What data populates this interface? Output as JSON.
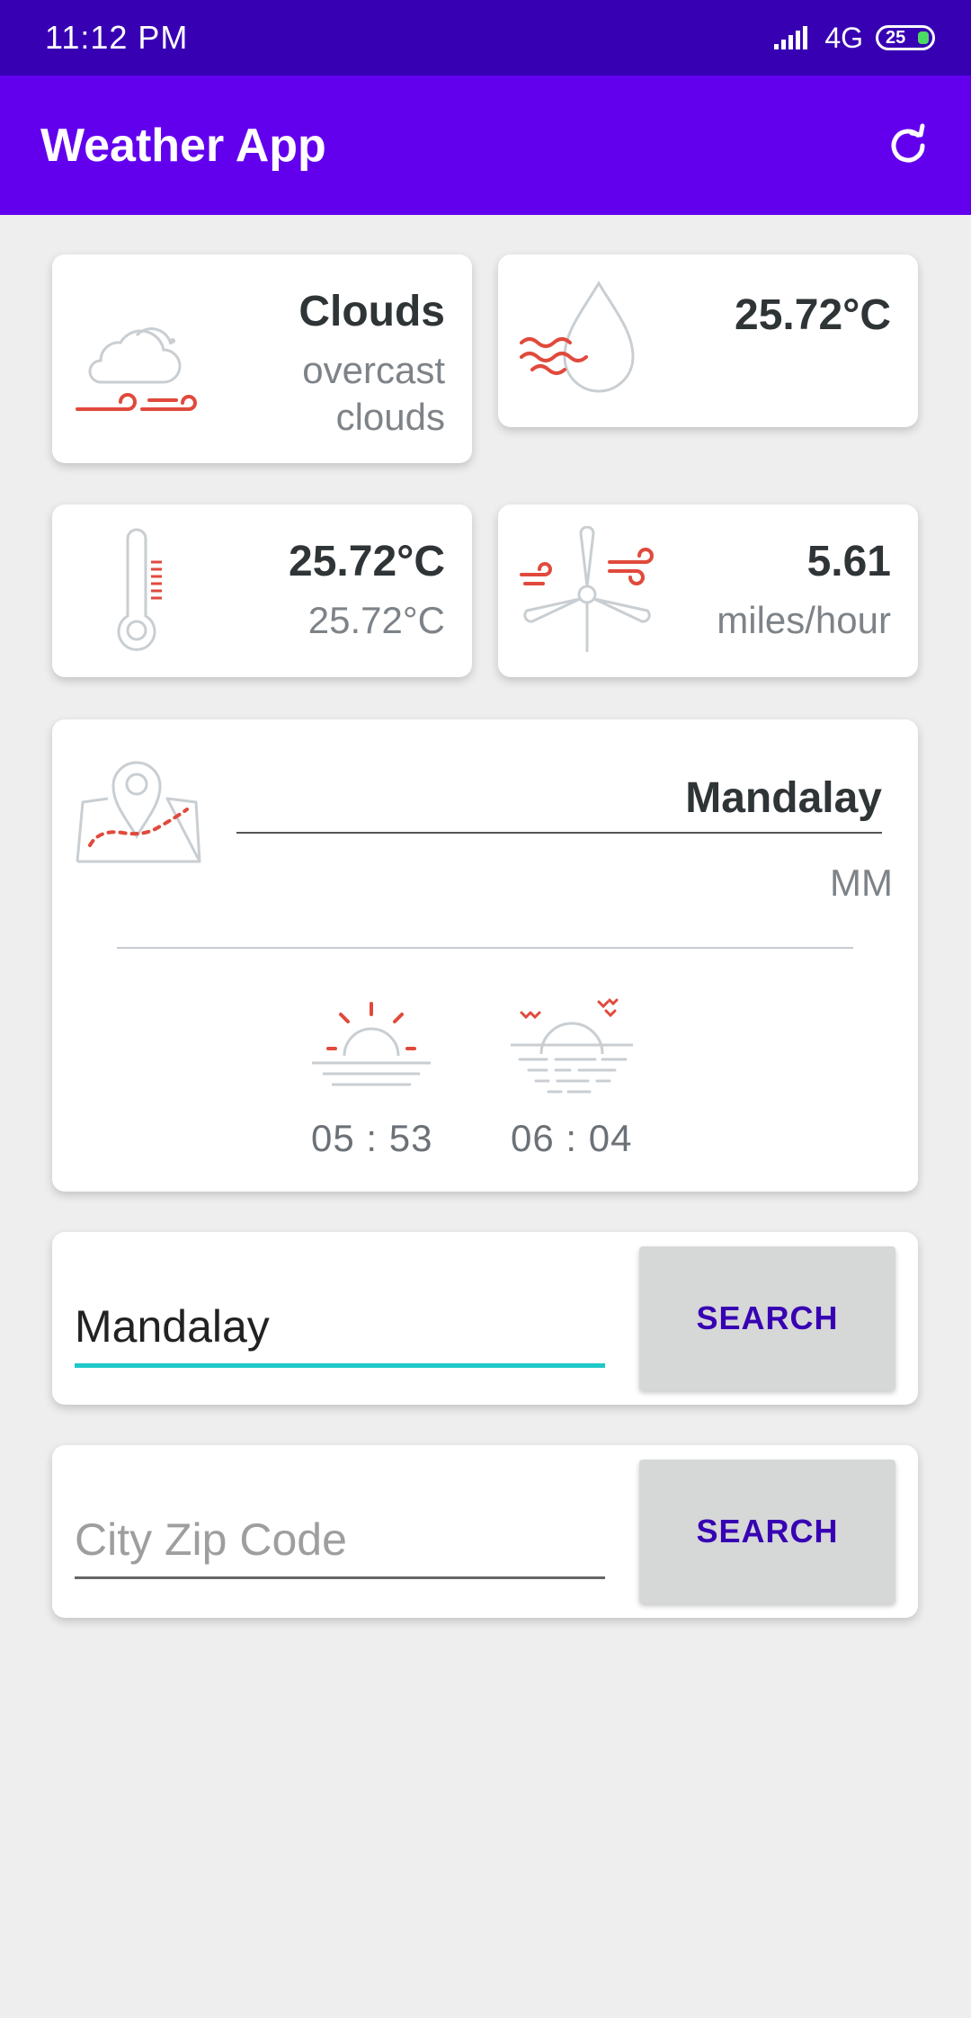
{
  "status_bar": {
    "time": "11:12  PM",
    "network": "4G",
    "battery": "25"
  },
  "app_bar": {
    "title": "Weather App"
  },
  "cards": {
    "condition": {
      "main": "Clouds",
      "description_line1": "overcast",
      "description_line2": "clouds"
    },
    "humidity": {
      "value": "25.72°C"
    },
    "temperature": {
      "value": "25.72°C",
      "secondary": "25.72°C"
    },
    "wind": {
      "speed": "5.61",
      "unit": "miles/hour"
    }
  },
  "location": {
    "city": "Mandalay",
    "country": "MM",
    "sunrise": "05 : 53",
    "sunset": "06 : 04"
  },
  "city_search": {
    "value": "Mandalay",
    "button": "SEARCH"
  },
  "zip_search": {
    "placeholder": "City Zip Code",
    "value": "",
    "button": "SEARCH"
  },
  "colors": {
    "status_bar": "#3700b3",
    "app_bar": "#6200ee",
    "accent": "#1fc8c8",
    "icon_red": "#e04a3c",
    "icon_gray": "#c9ced2"
  }
}
